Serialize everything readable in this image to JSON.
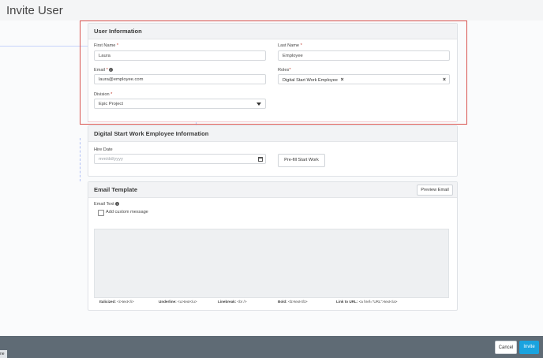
{
  "page": {
    "title": "Invite User"
  },
  "user_info": {
    "header": "User Information",
    "first_name": {
      "label": "First Name",
      "value": "Laura"
    },
    "last_name": {
      "label": "Last Name",
      "value": "Employee"
    },
    "email": {
      "label": "Email",
      "value": "laura@employee.com"
    },
    "roles": {
      "label": "Roles",
      "chip": "Digital Start Work Employee"
    },
    "division": {
      "label": "Division",
      "value": "Epic Project"
    }
  },
  "dsw_info": {
    "header": "Digital Start Work Employee Information",
    "hire_date": {
      "label": "Hire Date",
      "placeholder": "mm/dd/yyyy"
    },
    "prefill_button": "Pre-fill Start Work"
  },
  "email_template": {
    "header": "Email Template",
    "preview_button": "Preview Email",
    "email_text_label": "Email Text",
    "custom_message_label": "Add custom message",
    "hints": {
      "italicized": {
        "label": "Italicized:",
        "code": "<i>text</i>"
      },
      "underline": {
        "label": "Underline:",
        "code": "<u>text</u>"
      },
      "linebreak": {
        "label": "Linebreak:",
        "code": "<br />"
      },
      "bold": {
        "label": "Bold:",
        "code": "<b>text</b>"
      },
      "link": {
        "label": "Link to URL:",
        "code": "<a href=\"URL\">text</a>"
      }
    }
  },
  "footer": {
    "cancel": "Cancel",
    "invite": "Invite"
  },
  "corner_tag": "ne",
  "required_mark": "*",
  "info_glyph": "i",
  "remove_glyph": "×",
  "colors": {
    "accent": "#1aa3df",
    "footer": "#5f6b75",
    "highlight_border": "#d9534f"
  }
}
